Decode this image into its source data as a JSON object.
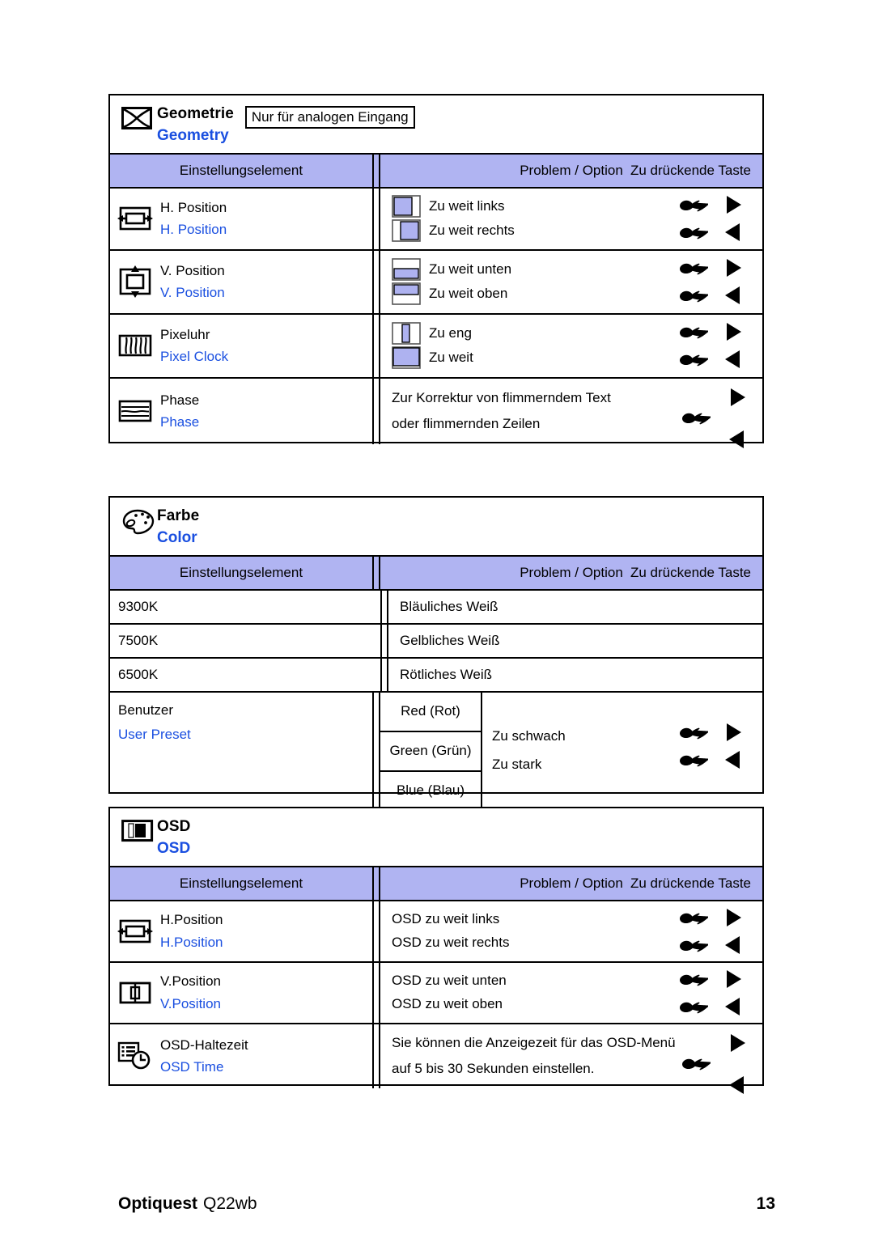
{
  "colors": {
    "header_blue_bg": "#b0b4f2",
    "link_blue": "#1a4fe0",
    "swatch_fill": "#aeb2f0",
    "border": "#000000"
  },
  "columns": {
    "setting": "Einstellungselement",
    "problem": "Problem / Option",
    "key": "Zu drückende Taste"
  },
  "sections": [
    {
      "id": "geometry",
      "title_de": "Geometrie",
      "title_en": "Geometry",
      "icon": "geometry-distortion-icon",
      "note": "Nur für analogen Eingang",
      "rows": [
        {
          "icon": "h-position-icon",
          "label_de": "H. Position",
          "label_en": "H. Position",
          "options": [
            {
              "swatch": "box-left-filled",
              "text": "Zu weit links",
              "hand": "☛",
              "tri": "▶"
            },
            {
              "swatch": "box-right-filled",
              "text": "Zu weit rechts",
              "hand": "☛",
              "tri": "◀"
            }
          ]
        },
        {
          "icon": "v-position-icon",
          "label_de": "V. Position",
          "label_en": "V. Position",
          "options": [
            {
              "swatch": "box-bottom-filled",
              "text": "Zu weit unten",
              "hand": "☛",
              "tri": "▶"
            },
            {
              "swatch": "box-top-filled",
              "text": "Zu weit oben",
              "hand": "☛",
              "tri": "◀"
            }
          ]
        },
        {
          "icon": "pixel-clock-icon",
          "label_de": "Pixeluhr",
          "label_en": "Pixel Clock",
          "options": [
            {
              "swatch": "box-narrow-filled",
              "text": "Zu eng",
              "hand": "☛",
              "tri": "▶"
            },
            {
              "swatch": "box-wide-filled",
              "text": "Zu weit",
              "hand": "☛",
              "tri": "◀"
            }
          ]
        },
        {
          "icon": "phase-icon",
          "label_de": "Phase",
          "label_en": "Phase",
          "paragraph": [
            "Zur Korrektur von flimmerndem Text",
            "oder flimmernden Zeilen"
          ],
          "keys_split": {
            "tri_top": "▶",
            "hand": "☛",
            "tri_bottom": "◀"
          }
        }
      ]
    },
    {
      "id": "color",
      "title_de": "Farbe",
      "title_en": "Color",
      "icon": "palette-icon",
      "simple_rows": [
        {
          "setting": "9300K",
          "problem": "Bläuliches Weiß"
        },
        {
          "setting": "7500K",
          "problem": "Gelbliches Weiß"
        },
        {
          "setting": "6500K",
          "problem": "Rötliches Weiß"
        }
      ],
      "user_preset": {
        "label_de": "Benutzer",
        "label_en": "User Preset",
        "channels": [
          "Red (Rot)",
          "Green (Grün)",
          "Blue (Blau)"
        ],
        "problems": [
          "Zu schwach",
          "Zu stark"
        ],
        "keys": [
          {
            "hand": "☛",
            "tri": "▶"
          },
          {
            "hand": "☛",
            "tri": "◀"
          }
        ]
      }
    },
    {
      "id": "osd",
      "title_de": "OSD",
      "title_en": "OSD",
      "icon": "osd-icon",
      "rows": [
        {
          "icon": "osd-h-position-icon",
          "label_de": "H.Position",
          "label_en": "H.Position",
          "options": [
            {
              "text": "OSD zu weit links",
              "hand": "☛",
              "tri": "▶"
            },
            {
              "text": "OSD zu weit rechts",
              "hand": "☛",
              "tri": "◀"
            }
          ]
        },
        {
          "icon": "osd-v-position-icon",
          "label_de": "V.Position",
          "label_en": "V.Position",
          "options": [
            {
              "text": "OSD zu weit unten",
              "hand": "☛",
              "tri": "▶"
            },
            {
              "text": "OSD zu weit oben",
              "hand": "☛",
              "tri": "◀"
            }
          ]
        },
        {
          "icon": "osd-time-icon",
          "label_de": "OSD-Haltezeit",
          "label_en": "OSD Time",
          "paragraph": [
            "Sie können die Anzeigezeit für das OSD-Menü",
            "auf 5 bis 30 Sekunden einstellen."
          ],
          "keys_split": {
            "tri_top": "▶",
            "hand": "☛",
            "tri_bottom": "◀"
          }
        }
      ]
    }
  ],
  "footer": {
    "brand": "Optiquest",
    "model": "Q22wb",
    "page_number": "13"
  }
}
